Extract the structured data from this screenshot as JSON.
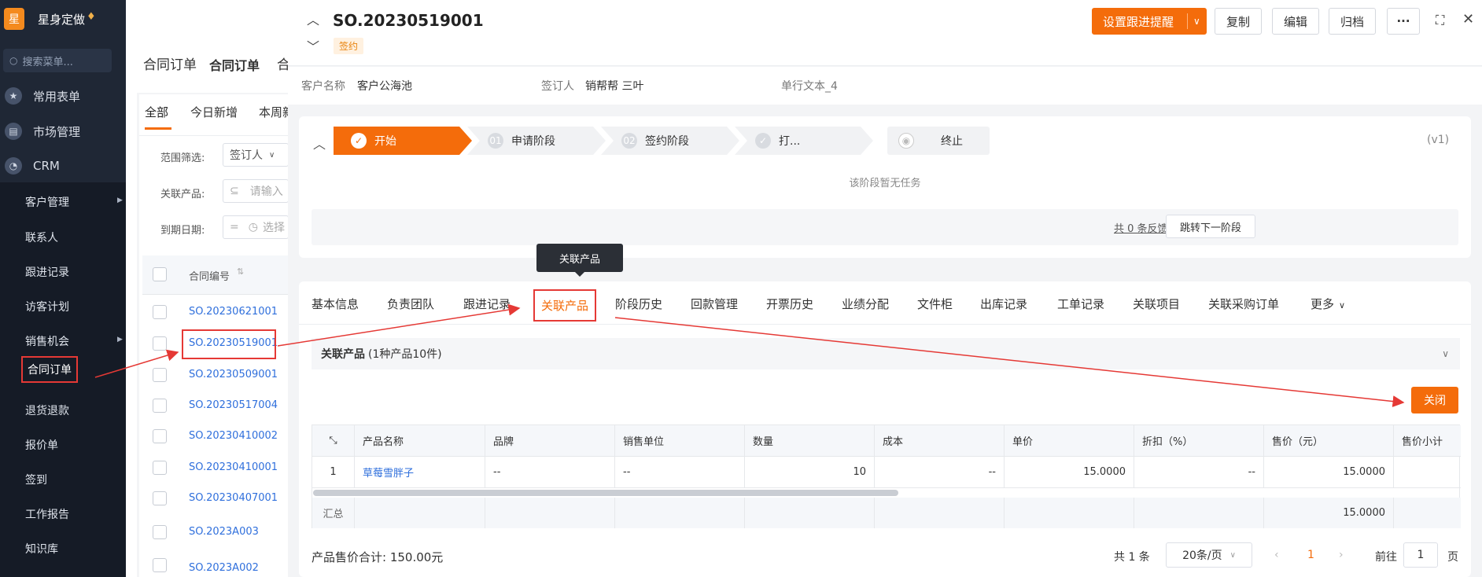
{
  "sidebar": {
    "logo": "星",
    "brand": "星身定做",
    "search_placeholder": "搜索菜单...",
    "top_items": [
      {
        "label": "常用表单",
        "icon": "star-icon"
      },
      {
        "label": "市场管理",
        "icon": "briefcase-icon"
      },
      {
        "label": "CRM",
        "icon": "pie-chart-icon"
      }
    ],
    "sub_items": [
      "客户管理",
      "联系人",
      "跟进记录",
      "访客计划",
      "销售机会",
      "合同订单",
      "退货退款",
      "报价单",
      "签到",
      "工作报告",
      "知识库"
    ]
  },
  "main": {
    "breadcrumb": [
      "合同订单",
      "合同订单",
      "合"
    ],
    "filter_tabs": [
      "全部",
      "今日新增",
      "本周新"
    ],
    "filters": [
      {
        "label": "范围筛选:",
        "value": "签订人"
      },
      {
        "label": "关联产品:",
        "value": "请输入"
      },
      {
        "label": "到期日期:",
        "value": "选择"
      }
    ],
    "column_header": "合同编号",
    "orders": [
      "SO.20230621001",
      "SO.20230519001",
      "SO.20230509001",
      "SO.20230517004",
      "SO.20230410002",
      "SO.20230410001",
      "SO.20230407001",
      "SO.2023A003",
      "SO.2023A002"
    ]
  },
  "detail": {
    "title": "SO.20230519001",
    "status_badge": "签约",
    "buttons": {
      "reminder": "设置跟进提醒",
      "copy": "复制",
      "edit": "编辑",
      "archive": "归档",
      "more": "···"
    },
    "info": [
      {
        "label": "客户名称",
        "value": "客户公海池"
      },
      {
        "label": "签订人",
        "value": "销帮帮 三叶"
      },
      {
        "label": "单行文本_4",
        "value": ""
      }
    ],
    "stages": [
      {
        "num": "✓",
        "label": "开始"
      },
      {
        "num": "01",
        "label": "申请阶段"
      },
      {
        "num": "02",
        "label": "签约阶段"
      },
      {
        "num": "✓",
        "label": "打..."
      },
      {
        "num": "◉",
        "label": "终止"
      }
    ],
    "version": "(v1)",
    "no_task": "该阶段暂无任务",
    "feedback": "共 0 条反馈",
    "jump_next": "跳转下一阶段",
    "tooltip": "关联产品",
    "tabs": [
      "基本信息",
      "负责团队",
      "跟进记录",
      "关联产品",
      "阶段历史",
      "回款管理",
      "开票历史",
      "业绩分配",
      "文件柜",
      "出库记录",
      "工单记录",
      "关联项目",
      "关联采购订单",
      "更多"
    ],
    "section_title": "关联产品",
    "section_count": "(1种产品10件)",
    "close_label": "关闭",
    "table": {
      "columns": [
        "产品名称",
        "品牌",
        "销售单位",
        "数量",
        "成本",
        "单价",
        "折扣（%）",
        "售价（元）",
        "售价小计"
      ],
      "rows": [
        {
          "index": "1",
          "name": "草莓雪胖子",
          "brand": "--",
          "unit": "--",
          "qty": "10",
          "cost": "--",
          "price": "15.0000",
          "discount": "--",
          "sale": "15.0000",
          "subtotal": ""
        }
      ],
      "summary_label": "汇总",
      "summary_sale": "15.0000"
    },
    "total_label": "产品售价合计: 150.00元",
    "pagination": {
      "total": "共 1 条",
      "page_size": "20条/页",
      "current": "1",
      "goto_label": "前往",
      "goto_value": "1",
      "page_suffix": "页"
    }
  },
  "colors": {
    "accent": "#f46c0b",
    "highlight": "#e53935",
    "link": "#2f6fdc",
    "sidebar_bg": "#1f2735"
  }
}
